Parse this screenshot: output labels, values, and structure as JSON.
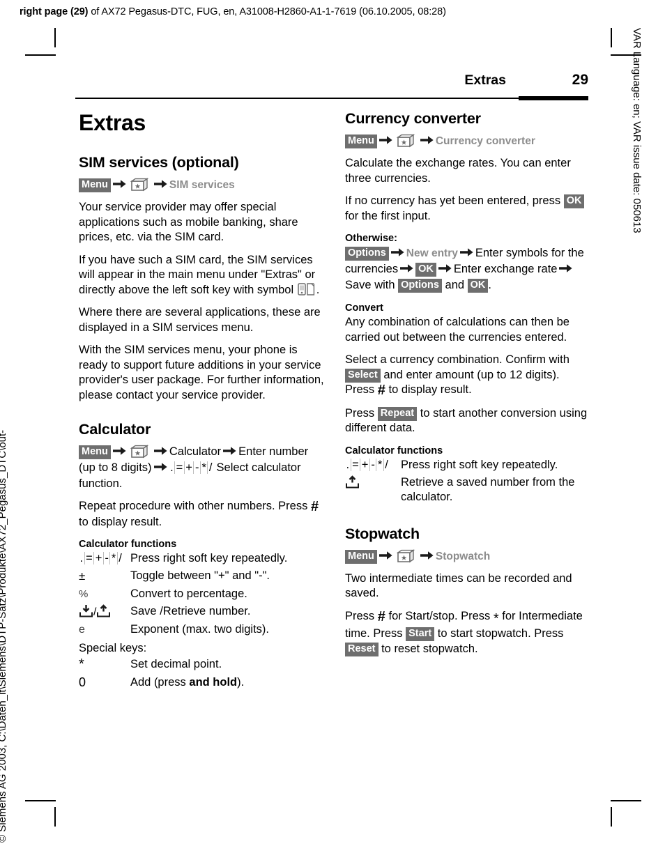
{
  "sheet": {
    "header_bold": "right page (29)",
    "header_rest": " of AX72 Pegasus-DTC, FUG, en, A31008-H2860-A1-1-7619 (06.10.2005, 08:28)",
    "margin_right": "VAR Language: en; VAR issue date: 050613",
    "margin_left": "© Siemens AG 2003, C:\\Daten_it\\Siemens\\DTP-Satz\\Produkte\\AX72_Pegasus_DTC\\out-"
  },
  "page_header": {
    "title": "Extras",
    "number": "29"
  },
  "chapter": {
    "title": "Extras"
  },
  "keys": {
    "menu": "Menu",
    "ok": "OK",
    "options": "Options",
    "select": "Select",
    "repeat": "Repeat",
    "start": "Start",
    "reset": "Reset",
    "softkeys": [
      ".",
      "=",
      "+",
      "-",
      "*",
      "/"
    ]
  },
  "sim_services": {
    "heading": "SIM services (optional)",
    "path_item": "SIM services",
    "p1": "Your service provider may offer special applications such as mobile banking, share prices, etc. via the SIM card.",
    "p2_before": "If you have such a SIM card, the SIM services will appear in the main menu under \"Extras\" or directly above the left soft key with symbol",
    "p2_after": ".",
    "p3": "Where there are several applications, these are displayed in a SIM services menu.",
    "p4": "With the SIM services menu, your phone is ready to support future additions in your service provider's user package. For further information, please contact your service provider."
  },
  "calculator": {
    "heading": "Calculator",
    "path_item": "Calculator",
    "path_enter": "Enter number (up to 8 digits)",
    "path_select": "Select calculator function.",
    "p1_before": "Repeat procedure with other numbers. Press",
    "p1_hash": "#",
    "p1_after": "to display result.",
    "functions_heading": "Calculator functions",
    "rows": [
      {
        "key": "softkeys",
        "desc": "Press right soft key repeatedly."
      },
      {
        "key": "±",
        "desc": "Toggle between \"+\" and \"-\"."
      },
      {
        "key": "%",
        "desc": "Convert to percentage."
      },
      {
        "key": "save-retrieve",
        "desc": "Save /Retrieve number."
      },
      {
        "key": "e",
        "desc": "Exponent (max. two digits)."
      }
    ],
    "special_label": "Special keys:",
    "special_rows": [
      {
        "key": "*",
        "desc": "Set decimal point."
      },
      {
        "key": "0",
        "desc_before": "Add (press",
        "desc_bold": "and hold",
        "desc_after": ")."
      }
    ]
  },
  "currency": {
    "heading": "Currency converter",
    "path_item": "Currency converter",
    "p1": "Calculate the exchange rates. You can enter three currencies.",
    "p2_before": "If no currency has yet been entered, press",
    "p2_after": "for the first input.",
    "otherwise_heading": "Otherwise:",
    "new_entry": "New entry",
    "seq_enter_symbols": "Enter symbols for the currencies",
    "seq_enter_rate": "Enter exchange rate",
    "seq_save_with": "Save with",
    "seq_and": "and",
    "seq_end": ".",
    "convert_heading": "Convert",
    "convert_p1": "Any combination of calculations can then be carried out between the currencies entered.",
    "convert_p2_a": "Select a currency combination. Confirm with",
    "convert_p2_b": "and enter amount (up to 12 digits). Press",
    "convert_p2_hash": "#",
    "convert_p2_c": "to display result.",
    "convert_p3_a": "Press",
    "convert_p3_b": "to start another conversion using different data.",
    "functions_heading": "Calculator functions",
    "rows": [
      {
        "key": "softkeys",
        "desc": "Press right soft key repeatedly."
      },
      {
        "key": "retrieve",
        "desc": "Retrieve a saved number from the calculator."
      }
    ]
  },
  "stopwatch": {
    "heading": "Stopwatch",
    "path_item": "Stopwatch",
    "p1": "Two intermediate times can be recorded and saved.",
    "p2_a": "Press",
    "p2_hash": "#",
    "p2_b": "for Start/stop. Press",
    "p2_star": "*",
    "p2_c": "for Intermediate time. Press",
    "p2_d": "to start stopwatch. Press",
    "p2_e": "to reset stopwatch."
  },
  "colors": {
    "key_background": "#6e6e6e",
    "menu_item_text": "#8c8c8c",
    "icon_gray": "#6b6b6b"
  }
}
